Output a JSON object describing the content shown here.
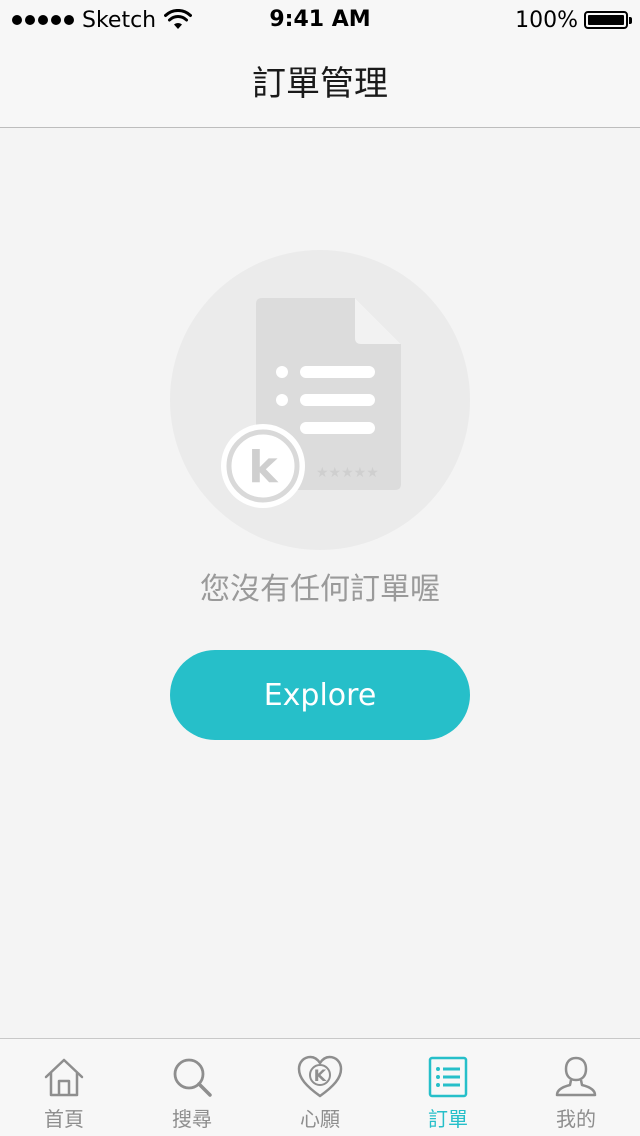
{
  "status_bar": {
    "carrier": "Sketch",
    "time": "9:41 AM",
    "battery_percent": "100%",
    "battery_level": 1.0,
    "signal_bars": 5
  },
  "nav": {
    "title": "訂單管理"
  },
  "empty_state": {
    "message": "您沒有任何訂單喔",
    "button_label": "Explore",
    "illustration_icon": "document-with-k-badge-icon",
    "badge_letter": "k"
  },
  "tabs": [
    {
      "label": "首頁",
      "icon": "home-icon",
      "active": false
    },
    {
      "label": "搜尋",
      "icon": "search-icon",
      "active": false
    },
    {
      "label": "心願",
      "icon": "heart-k-icon",
      "active": false,
      "badge_letter": "K"
    },
    {
      "label": "訂單",
      "icon": "list-icon",
      "active": true
    },
    {
      "label": "我的",
      "icon": "user-icon",
      "active": false
    }
  ],
  "colors": {
    "accent": "#26bfc9",
    "background": "#f4f4f4",
    "inactive": "#8e8e8e",
    "muted_text": "#9a9a9a"
  }
}
